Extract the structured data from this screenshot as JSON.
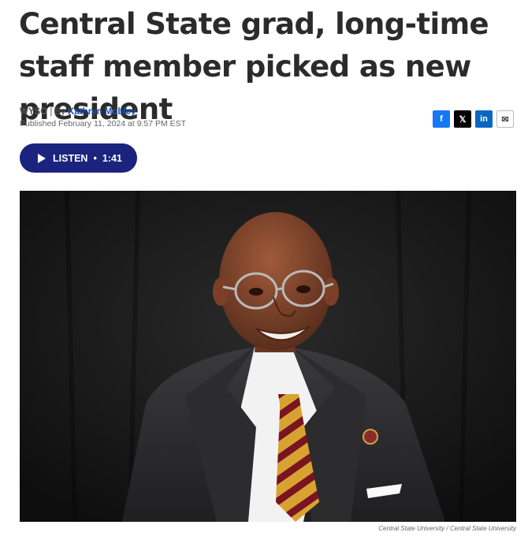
{
  "article": {
    "headline": "Central State grad, long-time staff member picked as new president",
    "source": "WYSO",
    "by_prefix": "| By",
    "author": "Kathryn Mobley",
    "published": "Published February 11, 2024 at 9:57 PM EST"
  },
  "share": {
    "facebook": "f",
    "x": "𝕏",
    "linkedin": "in",
    "email": "✉"
  },
  "listen": {
    "label": "LISTEN",
    "separator": "•",
    "duration": "1:41"
  },
  "photo": {
    "credit": "Central State University  /  Central State University"
  },
  "icons": {
    "play": "play-icon",
    "facebook": "facebook-icon",
    "x": "x-icon",
    "linkedin": "linkedin-icon",
    "email": "email-icon"
  },
  "colors": {
    "listen_bg": "#1a237e",
    "author_link": "#1b4fb5",
    "facebook": "#1877f2",
    "linkedin": "#0a66c2"
  }
}
